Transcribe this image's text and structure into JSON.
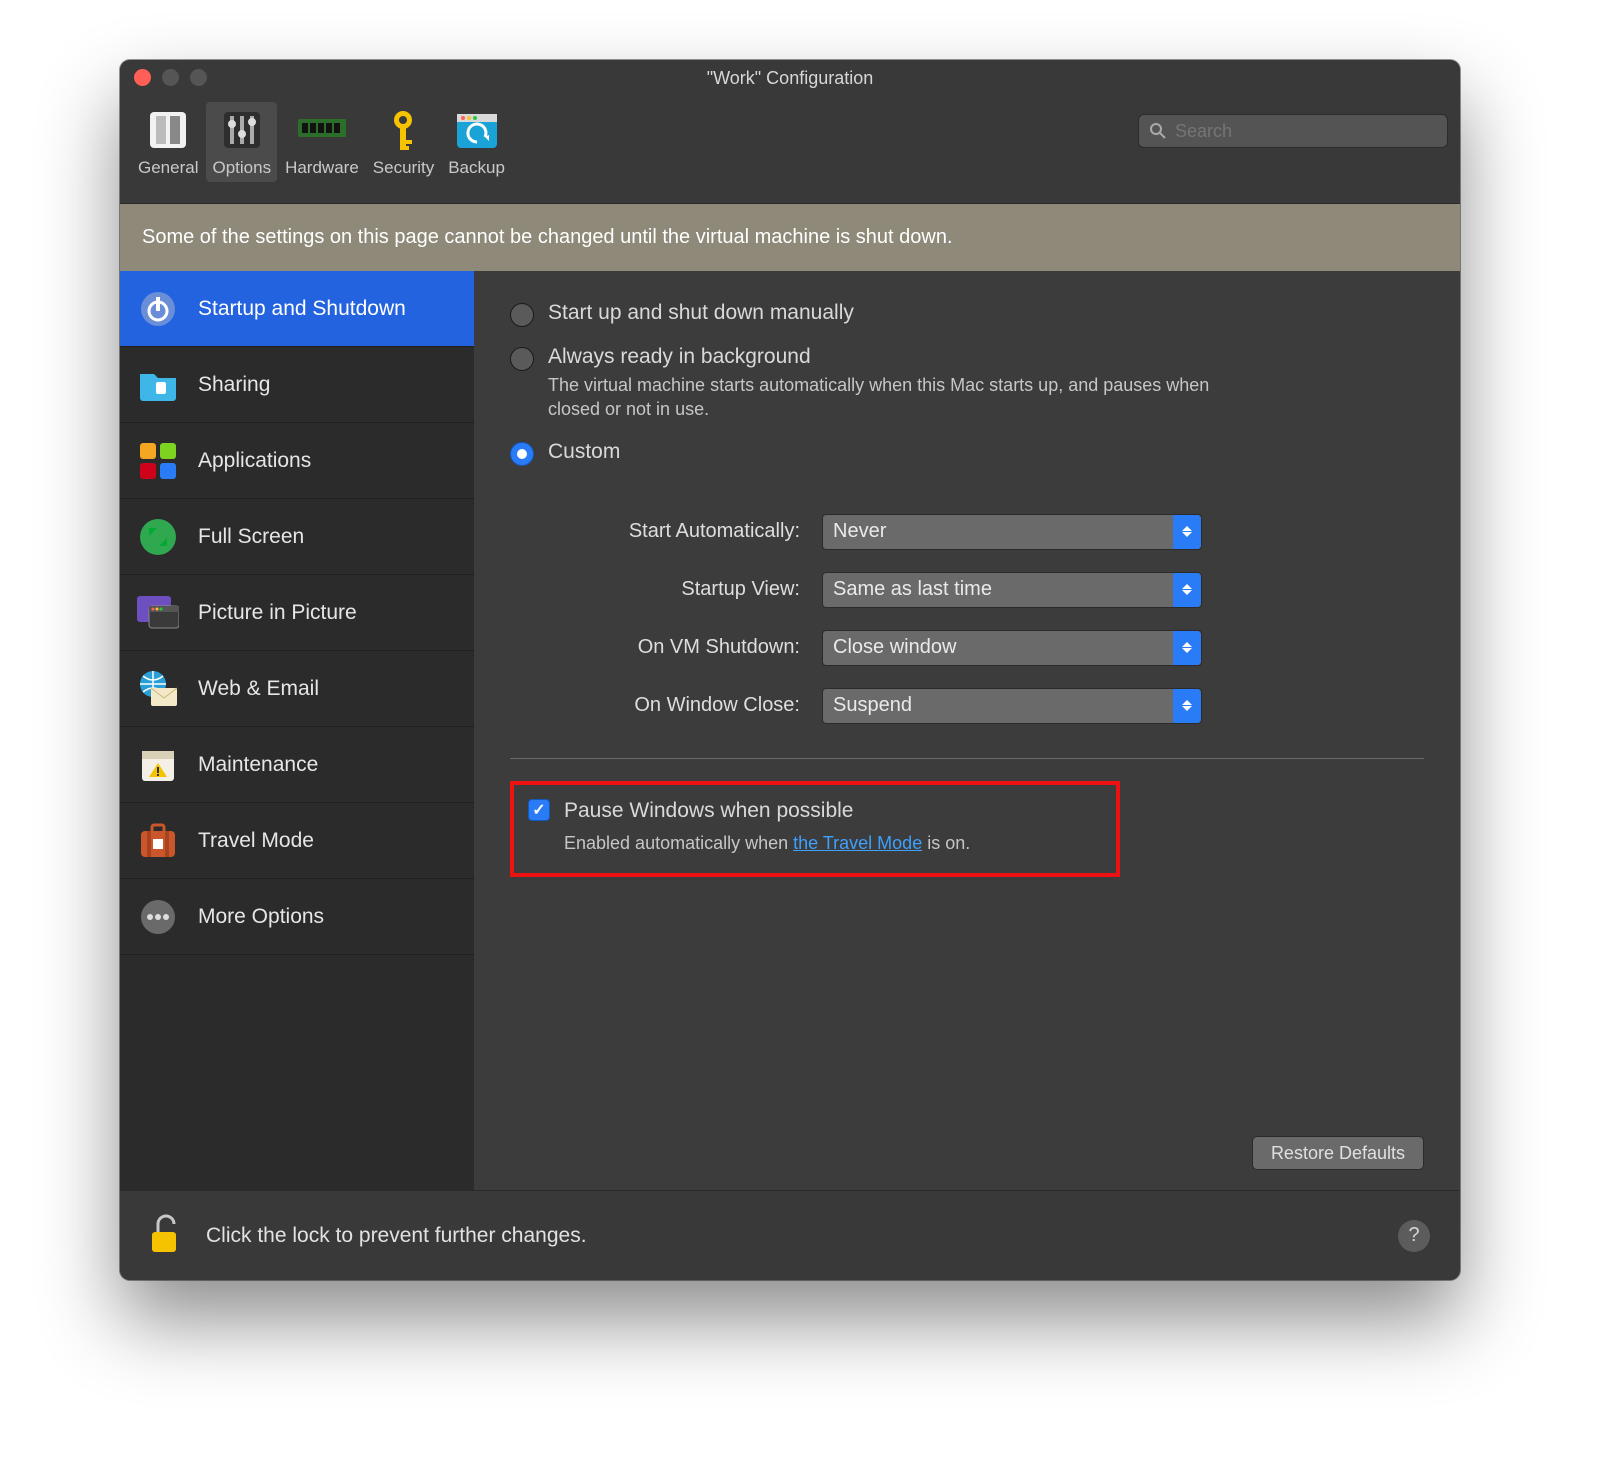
{
  "window": {
    "title": "\"Work\" Configuration"
  },
  "toolbar": {
    "items": [
      {
        "label": "General"
      },
      {
        "label": "Options"
      },
      {
        "label": "Hardware"
      },
      {
        "label": "Security"
      },
      {
        "label": "Backup"
      }
    ],
    "search_placeholder": "Search"
  },
  "banner": "Some of the settings on this page cannot be changed until the virtual machine is shut down.",
  "sidebar": {
    "items": [
      {
        "label": "Startup and Shutdown"
      },
      {
        "label": "Sharing"
      },
      {
        "label": "Applications"
      },
      {
        "label": "Full Screen"
      },
      {
        "label": "Picture in Picture"
      },
      {
        "label": "Web & Email"
      },
      {
        "label": "Maintenance"
      },
      {
        "label": "Travel Mode"
      },
      {
        "label": "More Options"
      }
    ]
  },
  "content": {
    "radio_manual": "Start up and shut down manually",
    "radio_ready": "Always ready in background",
    "radio_ready_sub": "The virtual machine starts automatically when this Mac starts up, and pauses when closed or not in use.",
    "radio_custom": "Custom",
    "labels": {
      "start_auto": "Start Automatically:",
      "startup_view": "Startup View:",
      "on_shutdown": "On VM Shutdown:",
      "on_close": "On Window Close:"
    },
    "values": {
      "start_auto": "Never",
      "startup_view": "Same as last time",
      "on_shutdown": "Close window",
      "on_close": "Suspend"
    },
    "pause_label": "Pause Windows when possible",
    "pause_sub_pre": "Enabled automatically when ",
    "pause_sub_link": "the Travel Mode",
    "pause_sub_post": " is on.",
    "restore": "Restore Defaults"
  },
  "footer": {
    "lock_text": "Click the lock to prevent further changes.",
    "help": "?"
  }
}
